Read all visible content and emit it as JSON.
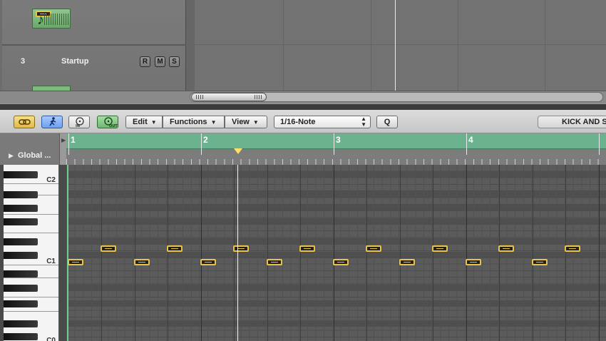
{
  "arrange": {
    "track": {
      "number": "3",
      "name": "Startup",
      "buttons": [
        "R",
        "M",
        "S"
      ]
    }
  },
  "toolbar": {
    "edit_label": "Edit",
    "functions_label": "Functions",
    "view_label": "View",
    "quantize_value": "1/16-Note",
    "q_label": "Q",
    "region_name": "KICK AND S"
  },
  "ruler": {
    "global_tracks_label": "Global ...",
    "bars": [
      "1",
      "2",
      "3",
      "4"
    ]
  },
  "keyboard": {
    "labels": [
      "C2",
      "C1",
      "C0"
    ]
  },
  "colors": {
    "cycle": "#6bb38f",
    "note_border": "#e9c24a",
    "link_button": "#e2b94a",
    "catch_button": "#6aa0ee",
    "midi_out": "#6db86d"
  },
  "icons": {
    "link": "link-icon",
    "catch": "catch-playhead-icon",
    "midi_in": "midi-in-icon",
    "midi_out": "midi-out-icon"
  }
}
